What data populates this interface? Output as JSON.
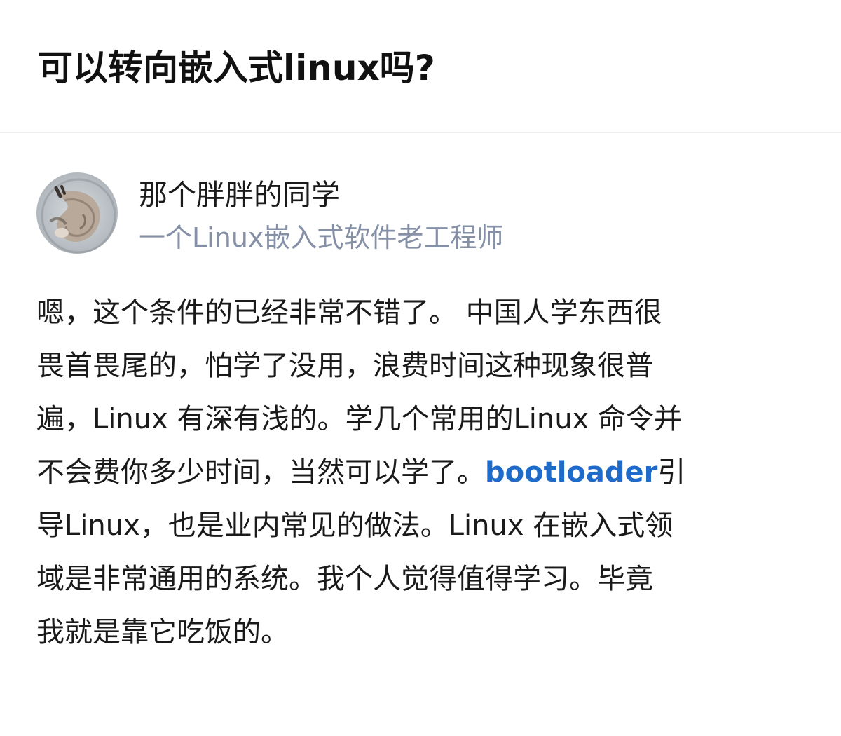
{
  "question": {
    "title": "可以转向嵌入式linux吗?"
  },
  "answer": {
    "author": {
      "name": "那个胖胖的同学",
      "headline": "一个Linux嵌入式软件老工程师"
    },
    "body_lines": [
      "嗯，这个条件的已经非常不错了。 中国人学东西很",
      "畏首畏尾的，怕学了没用，浪费时间这种现象很普",
      "遍，Linux 有深有浅的。学几个常用的Linux 命令并",
      {
        "before": "不会费你多少时间，当然可以学了。",
        "link": "bootloader",
        "after": "引"
      },
      "导Linux，也是业内常见的做法。Linux 在嵌入式领",
      "域是非常通用的系统。我个人觉得值得学习。毕竟",
      "我就是靠它吃饭的。"
    ]
  },
  "colors": {
    "title": "#111111",
    "text": "#1a1a1a",
    "headline": "#8590a6",
    "link": "#1e6bc9",
    "divider": "#f0f0f0"
  },
  "icons": {
    "avatar": "cat-photo-avatar"
  }
}
